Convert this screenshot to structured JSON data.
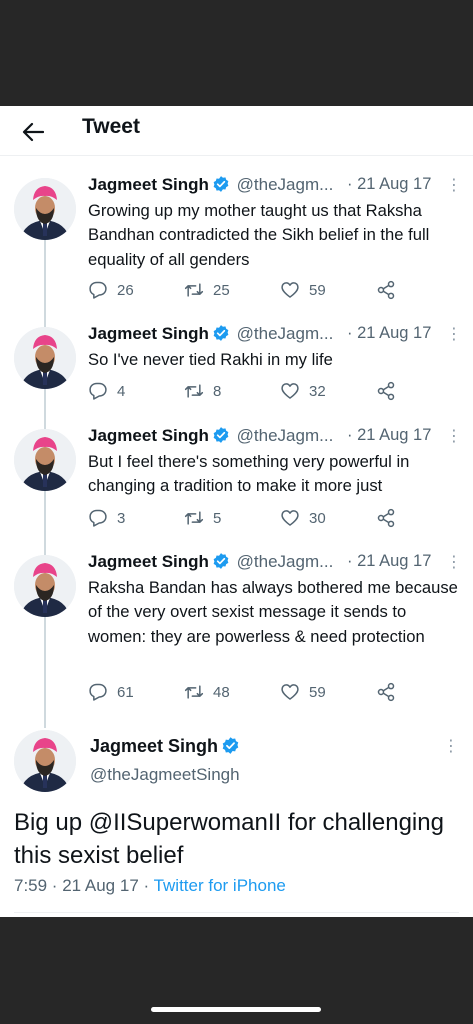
{
  "header": {
    "title": "Tweet"
  },
  "colors": {
    "verified": "#1d9bf0",
    "link": "#1d9bf0",
    "secondary_text": "#536471",
    "status_bar": "#272727"
  },
  "tweets": [
    {
      "name": "Jagmeet Singh",
      "handle": "@theJagm...",
      "date": "· 21 Aug 17",
      "more": "⋮",
      "text": "Growing up my mother taught us that Raksha Bandhan contradicted the Sikh belief in the full equality of all genders",
      "replies": "26",
      "retweets": "25",
      "likes": "59"
    },
    {
      "name": "Jagmeet Singh",
      "handle": "@theJagm...",
      "date": "· 21 Aug 17",
      "more": "⋮",
      "text": "So I've never tied Rakhi in my life",
      "replies": "4",
      "retweets": "8",
      "likes": "32"
    },
    {
      "name": "Jagmeet Singh",
      "handle": "@theJagm...",
      "date": "· 21 Aug 17",
      "more": "⋮",
      "text": "But I feel there's something very powerful in changing a tradition to make it more just",
      "replies": "3",
      "retweets": "5",
      "likes": "30"
    },
    {
      "name": "Jagmeet Singh",
      "handle": "@theJagm...",
      "date": "· 21 Aug 17",
      "more": "⋮",
      "text": "Raksha Bandan has always bothered me because of the very overt sexist message it sends to women: they are powerless & need protection",
      "replies": "61",
      "retweets": "48",
      "likes": "59"
    }
  ],
  "main_tweet": {
    "name": "Jagmeet Singh",
    "handle": "@theJagmeetSingh",
    "more": "⋮",
    "text": "Big up @IISuperwomanII for challenging this sexist belief",
    "time": "7:59 · 21 Aug 17 · ",
    "source": "Twitter for iPhone"
  }
}
